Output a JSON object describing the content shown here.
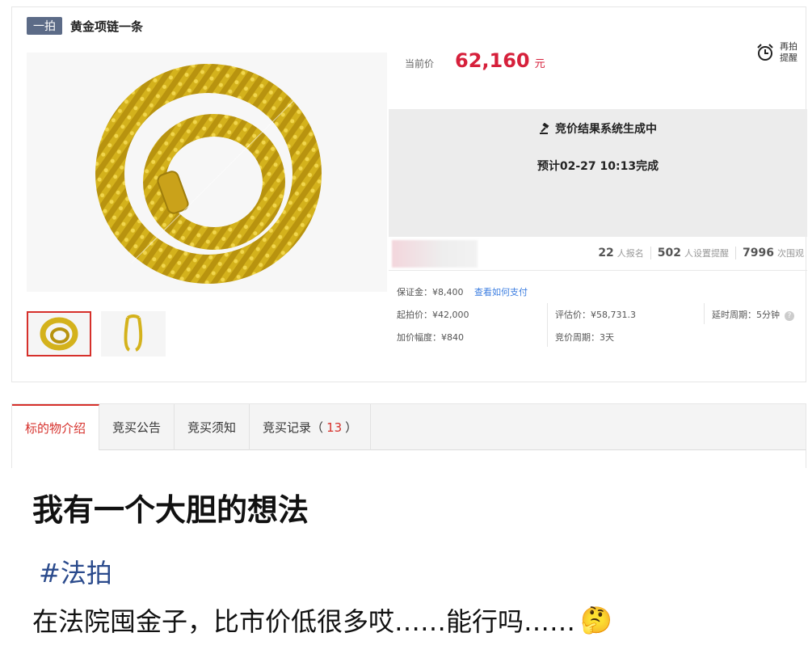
{
  "item": {
    "tag": "一拍",
    "title": "黄金项链一条"
  },
  "price": {
    "label": "当前价",
    "value": "62,160",
    "unit": "元"
  },
  "remind": {
    "icon": "alarm-clock-icon",
    "label_line1": "再拍",
    "label_line2": "提醒"
  },
  "status": {
    "line1": "竞价结果系统生成中",
    "line2": "预计02-27 10:13完成"
  },
  "stats": {
    "signups_num": "22",
    "signups_label": "人报名",
    "reminders_num": "502",
    "reminders_label": "人设置提醒",
    "views_num": "7996",
    "views_label": "次围观"
  },
  "info": {
    "deposit": "保证金：¥8,400",
    "how_to_pay": "查看如何支付",
    "start_price": "起拍价：¥42,000",
    "appraisal": "评估价：¥58,731.3",
    "delay": "延时周期：5分钟",
    "increment": "加价幅度：¥840",
    "bid_cycle": "竞价周期：3天"
  },
  "tabs": [
    {
      "label": "标的物介绍"
    },
    {
      "label": "竞买公告"
    },
    {
      "label": "竞买须知"
    },
    {
      "label": "竞买记录（",
      "count": "13",
      "suffix": "）"
    }
  ],
  "post": {
    "caption": "我有一个大胆的想法",
    "hashtag": "#法拍",
    "body": "在法院囤金子，比市价低很多哎……能行吗……",
    "emoji": "🤔"
  },
  "colors": {
    "accent_red": "#d6203b",
    "tag_bg": "#5c6b87",
    "link_blue": "#3c7ee0",
    "hashtag_blue": "#2a4a8c",
    "gold": "#d4b21c"
  }
}
